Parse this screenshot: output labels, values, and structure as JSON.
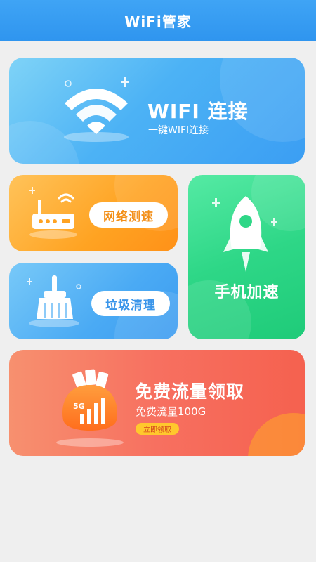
{
  "app": {
    "title": "WiFi管家"
  },
  "wifi_card": {
    "title": "WIFI 连接",
    "subtitle": "一键WIFI连接",
    "icon": "wifi-icon"
  },
  "speed_card": {
    "label": "网络测速",
    "icon": "router-icon"
  },
  "clean_card": {
    "label": "垃圾清理",
    "icon": "broom-icon"
  },
  "boost_card": {
    "label": "手机加速",
    "icon": "rocket-icon"
  },
  "free_card": {
    "title": "免费流量领取",
    "subtitle": "免费流量100G",
    "button": "立即领取",
    "badge": "5G",
    "icon": "signal-bag-icon"
  },
  "colors": {
    "header": "#2f95ef",
    "wifi": "#4cb2f5",
    "speed": "#ffa322",
    "clean": "#4aaaf4",
    "boost": "#2ed787",
    "free": "#f77060"
  }
}
